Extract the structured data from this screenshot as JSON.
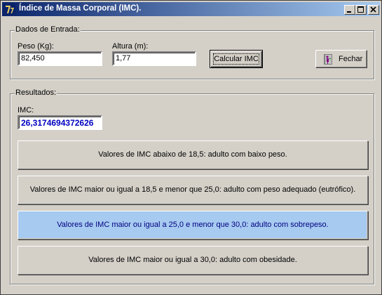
{
  "window": {
    "title": "Índice de Massa Corporal (IMC)."
  },
  "input_group": {
    "label": "Dados de Entrada:",
    "weight_label": "Peso (Kg):",
    "weight_value": "82,450",
    "height_label": "Altura (m):",
    "height_value": "1,77",
    "calc_button": "Calcular IMC",
    "close_button": "Fechar"
  },
  "results_group": {
    "label": "Resultados:",
    "imc_label": "IMC:",
    "imc_value": "26,3174694372626",
    "ranges": [
      {
        "text": "Valores de IMC abaixo de 18,5: adulto com baixo peso.",
        "active": false
      },
      {
        "text": "Valores de IMC maior ou igual a 18,5 e menor que 25,0: adulto com peso adequado (eutrófico).",
        "active": false
      },
      {
        "text": "Valores de IMC maior ou igual a 25,0 e menor que 30,0: adulto com sobrepeso.",
        "active": true
      },
      {
        "text": "Valores de IMC maior ou igual a 30,0: adulto com obesidade.",
        "active": false
      }
    ]
  },
  "colors": {
    "title_start": "#0a246a",
    "title_end": "#a6caf0",
    "highlight": "#a6caf0",
    "value_text": "#0000c0"
  }
}
